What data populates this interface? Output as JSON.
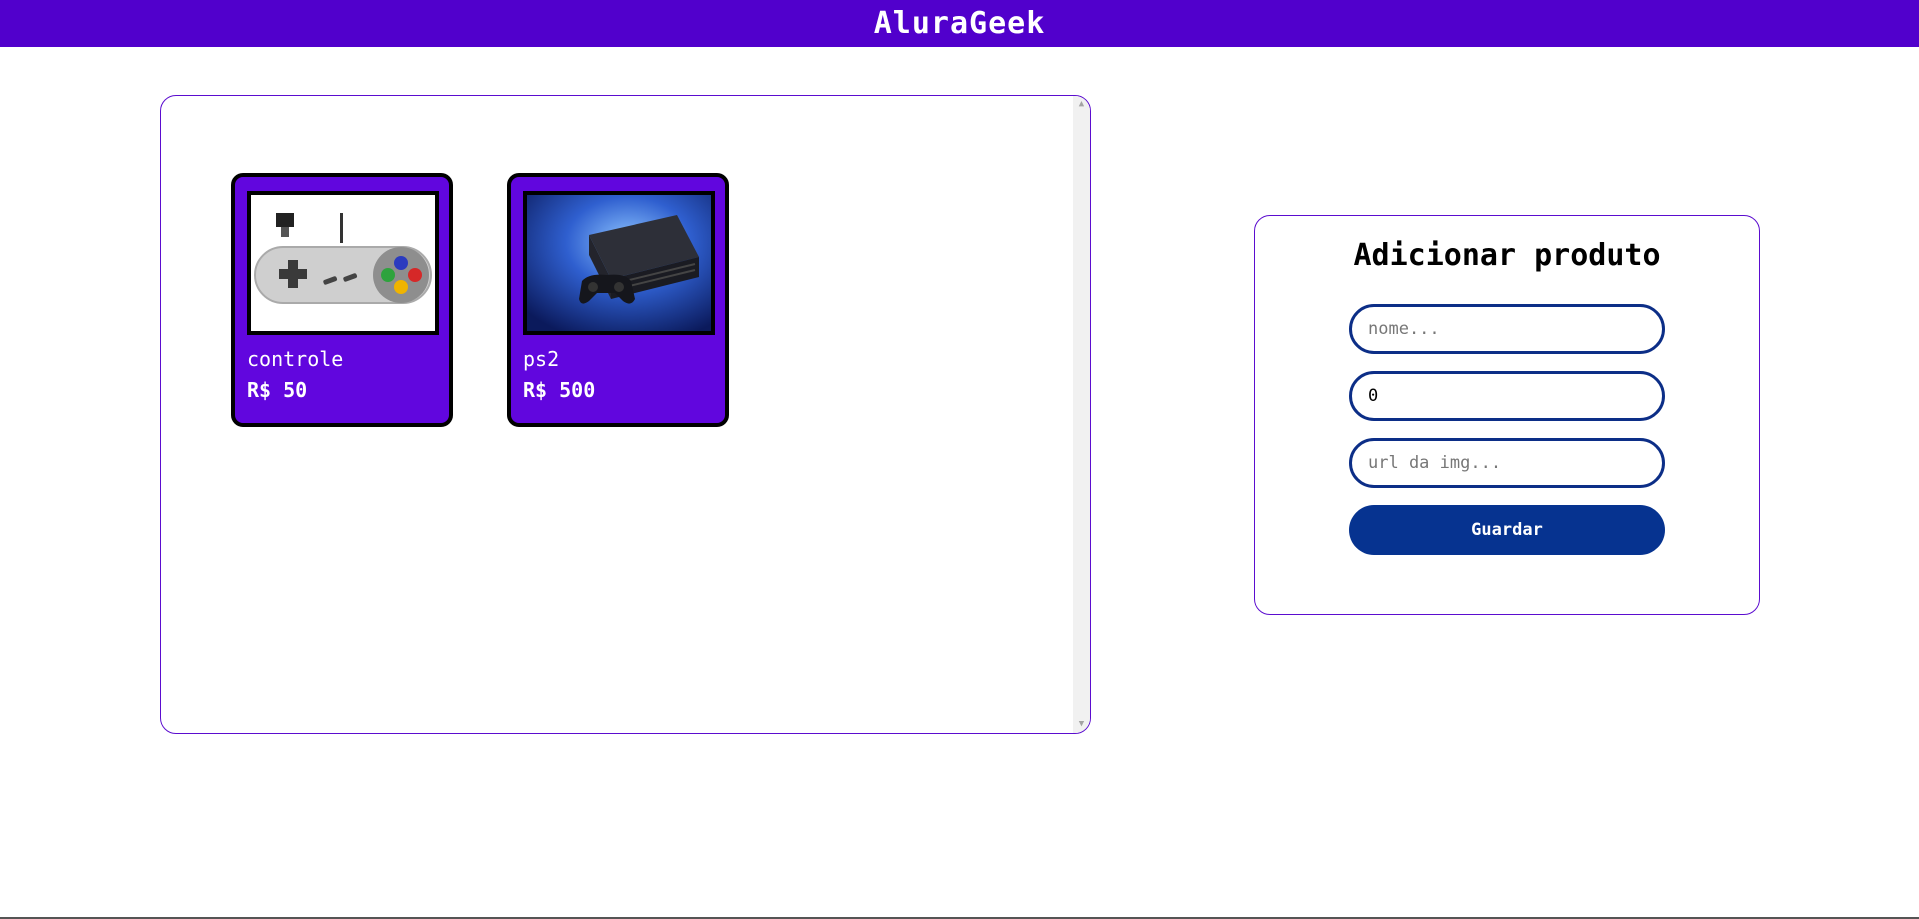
{
  "header": {
    "title": "AluraGeek"
  },
  "products": [
    {
      "name": "controle",
      "price": "R$ 50",
      "image": "snes-controller-image"
    },
    {
      "name": "ps2",
      "price": "R$ 500",
      "image": "ps2-console-image"
    }
  ],
  "form": {
    "title": "Adicionar produto",
    "name_placeholder": "nome...",
    "price_value": "0",
    "url_placeholder": "url da img...",
    "save_label": "Guardar"
  },
  "colors": {
    "header": "#5100cc",
    "card": "#6106de",
    "button": "#063390",
    "field_border": "#0c2e87",
    "panel_border": "#5b0ccf"
  }
}
